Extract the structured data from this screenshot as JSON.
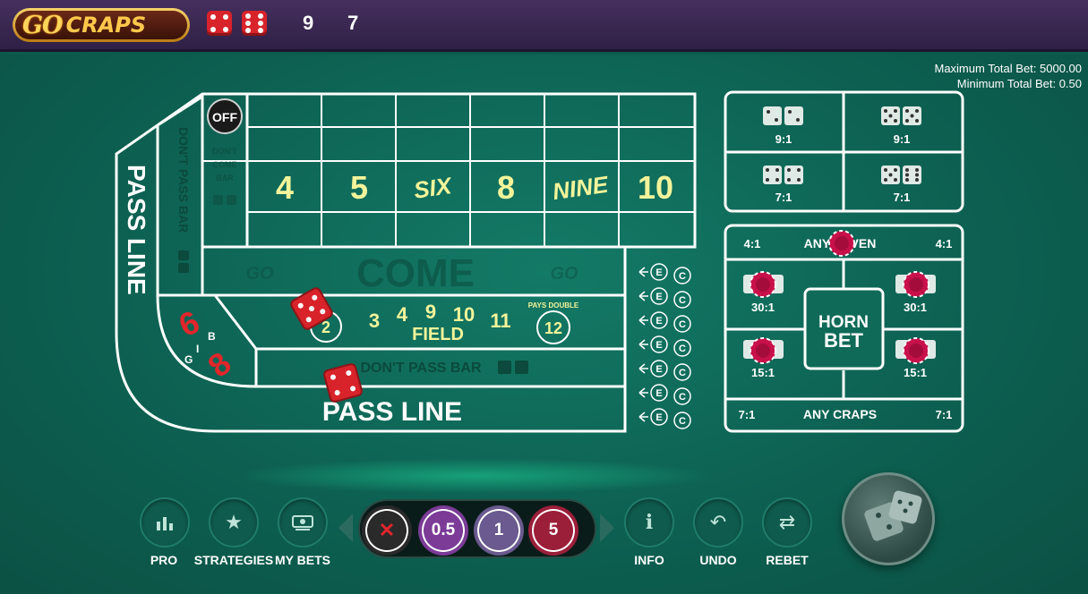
{
  "header": {
    "logo_go": "GO",
    "logo_craps": "CRAPS",
    "last_roll": [
      "9",
      "7"
    ]
  },
  "limits": {
    "max_total_bet": "Maximum Total Bet: 5000.00",
    "min_total_bet": "Minimum Total Bet: 0.50"
  },
  "table": {
    "off_puck": "OFF",
    "place_numbers": [
      "4",
      "5",
      "SIX",
      "8",
      "NINE",
      "10"
    ],
    "dont_pass_bar_side": "DON'T PASS BAR",
    "dont_come_bar": [
      "DON'T",
      "COME",
      "BAR"
    ],
    "pass_line_side": "PASS LINE",
    "come": "COME",
    "go_watermark": "GO",
    "field_numbers": [
      "3",
      "4",
      "9",
      "10",
      "11"
    ],
    "field_label": "FIELD",
    "field_2": "2",
    "field_12": "12",
    "pays_double": "PAYS DOUBLE",
    "big_6": "6",
    "big_8": "8",
    "big_label": "BIG",
    "dont_pass_bar": "DON'T PASS BAR",
    "pass_line": "PASS LINE",
    "ce_rows": 7,
    "ce_e": "E",
    "ce_c": "C"
  },
  "hardways": [
    {
      "payout": "9:1"
    },
    {
      "payout": "9:1"
    },
    {
      "payout": "7:1"
    },
    {
      "payout": "7:1"
    }
  ],
  "props": {
    "any_seven": "ANY SEVEN",
    "any_seven_left_odds": "4:1",
    "any_seven_right_odds": "4:1",
    "horn_line1": "HORN",
    "horn_line2": "BET",
    "tl_payout": "30:1",
    "tr_payout": "30:1",
    "bl_payout": "15:1",
    "br_payout": "15:1",
    "any_craps": "ANY CRAPS",
    "any_craps_left_odds": "7:1",
    "any_craps_right_odds": "7:1"
  },
  "controls": {
    "pro": "PRO",
    "strategies": "STRATEGIES",
    "my_bets": "MY BETS",
    "info": "INFO",
    "undo": "UNDO",
    "rebet": "REBET"
  },
  "chips": [
    {
      "label": "✕",
      "color": "#2a2a2a"
    },
    {
      "label": "0.5",
      "color": "#7b3b97"
    },
    {
      "label": "1",
      "color": "#6a5a8f"
    },
    {
      "label": "5",
      "color": "#9c1f3a"
    }
  ],
  "colors": {
    "felt": "#0d6152",
    "header": "#3a2752",
    "place_text": "#f3f49a",
    "big_red": "#e0262b",
    "chip_pink": "#c8104a"
  }
}
